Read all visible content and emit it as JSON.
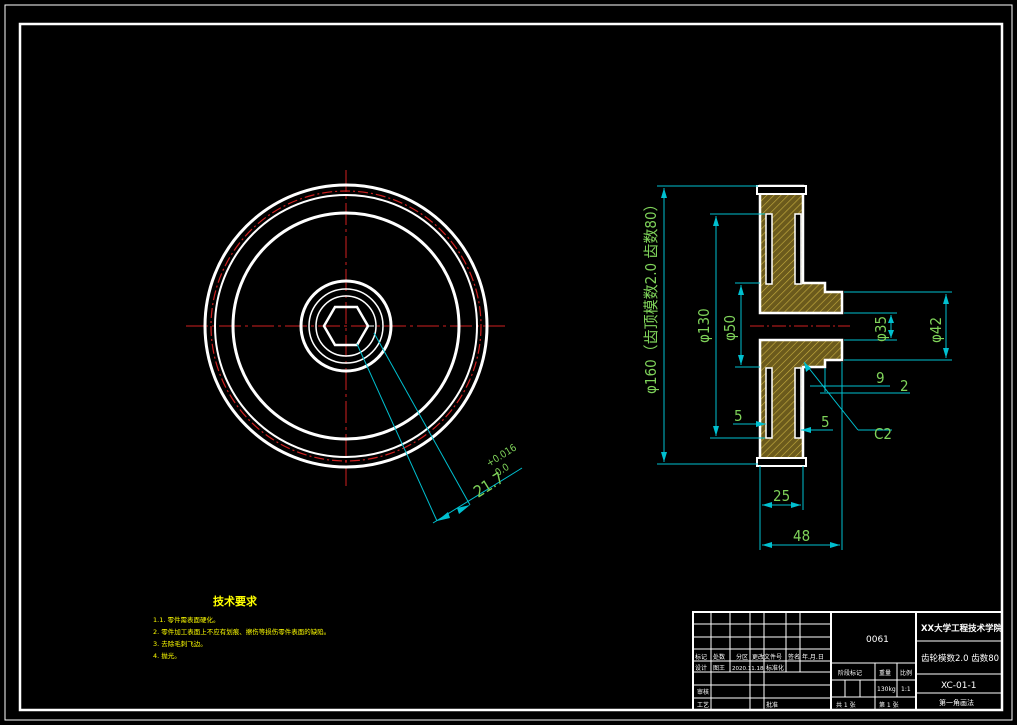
{
  "drawing": {
    "dims": {
      "hex": "21.7",
      "hex_tol_upper": "+0.016",
      "hex_tol_lower": "-0.0",
      "dia_outer": "φ160（齿顶模数2.0 齿数80）",
      "dia_rim": "φ130",
      "dia_hub_out": "φ50",
      "dia_bore": "φ35",
      "dia_flange": "φ42",
      "d9": "9",
      "d2": "2",
      "d5a": "5",
      "d5b": "5",
      "chamfer": "C2",
      "w25": "25",
      "w48": "48"
    },
    "notes": {
      "title": "技术要求",
      "items": [
        "1.1. 零件需表面硬化。",
        "2. 零件加工表面上不应有划痕、擦伤等损伤零件表面的缺陷。",
        "3. 去除毛刺飞边。",
        "4. 抛光。"
      ]
    },
    "title_block": {
      "material": "0061",
      "school": "XX大学工程技术学院",
      "part_name": "齿轮模数2.0 齿数80",
      "drawing_no": "XC-01-1",
      "row_labels": [
        "标记",
        "处数",
        "分区",
        "更改文件号",
        "签名",
        "年.月.日"
      ],
      "designer_label": "设计",
      "designer": "图王",
      "date": "2020.11.18",
      "std_label": "标准化",
      "review_label": "审核",
      "process_label": "工艺",
      "approve_label": "批准",
      "stage_label": "阶段标记",
      "weight_label": "重量",
      "scale_label": "比例",
      "weight": "130kg",
      "scale": "1:1",
      "sheets": "共 1 张",
      "sheet": "第 1 张",
      "footer": "第一角画法"
    }
  }
}
